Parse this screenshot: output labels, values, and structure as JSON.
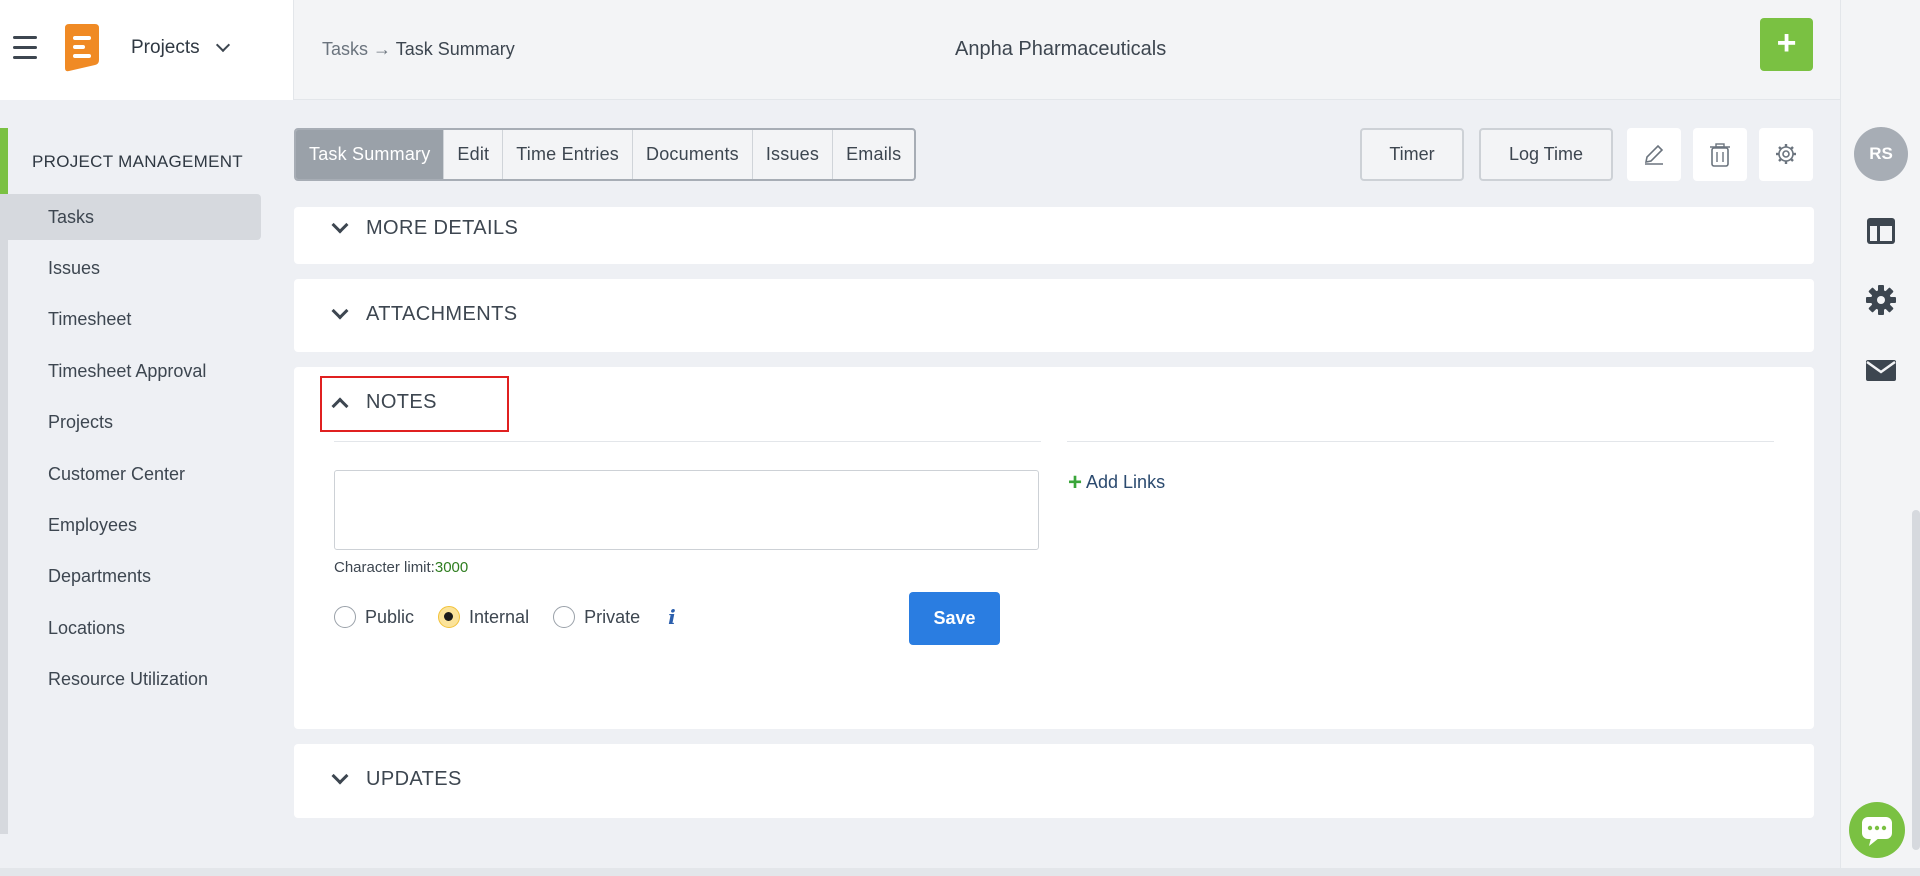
{
  "header": {
    "project_switcher": "Projects",
    "breadcrumb": {
      "parent": "Tasks",
      "separator": "→",
      "current": "Task Summary"
    },
    "company": "Anpha Pharmaceuticals",
    "add_button": "+"
  },
  "user": {
    "initials": "RS"
  },
  "sidebar": {
    "heading": "PROJECT MANAGEMENT",
    "items": [
      {
        "label": "Tasks",
        "active": true
      },
      {
        "label": "Issues"
      },
      {
        "label": "Timesheet"
      },
      {
        "label": "Timesheet Approval"
      },
      {
        "label": "Projects"
      },
      {
        "label": "Customer Center"
      },
      {
        "label": "Employees"
      },
      {
        "label": "Departments"
      },
      {
        "label": "Locations"
      },
      {
        "label": "Resource Utilization"
      }
    ]
  },
  "tabs": [
    "Task Summary",
    "Edit",
    "Time Entries",
    "Documents",
    "Issues",
    "Emails"
  ],
  "toolbar": {
    "timer": "Timer",
    "log_time": "Log Time"
  },
  "sections": {
    "more_details": "MORE DETAILS",
    "attachments": "ATTACHMENTS",
    "notes": "NOTES",
    "updates": "UPDATES"
  },
  "notes": {
    "textarea_value": "",
    "char_limit_label": "Character limit:",
    "char_limit_value": "3000",
    "visibility": [
      {
        "label": "Public",
        "checked": false
      },
      {
        "label": "Internal",
        "checked": true
      },
      {
        "label": "Private",
        "checked": false
      }
    ],
    "info": "i",
    "save": "Save",
    "add_links": "Add Links"
  },
  "colors": {
    "accent_green": "#7ac142",
    "primary_blue": "#2a7de1",
    "highlight_red": "#e02020"
  }
}
